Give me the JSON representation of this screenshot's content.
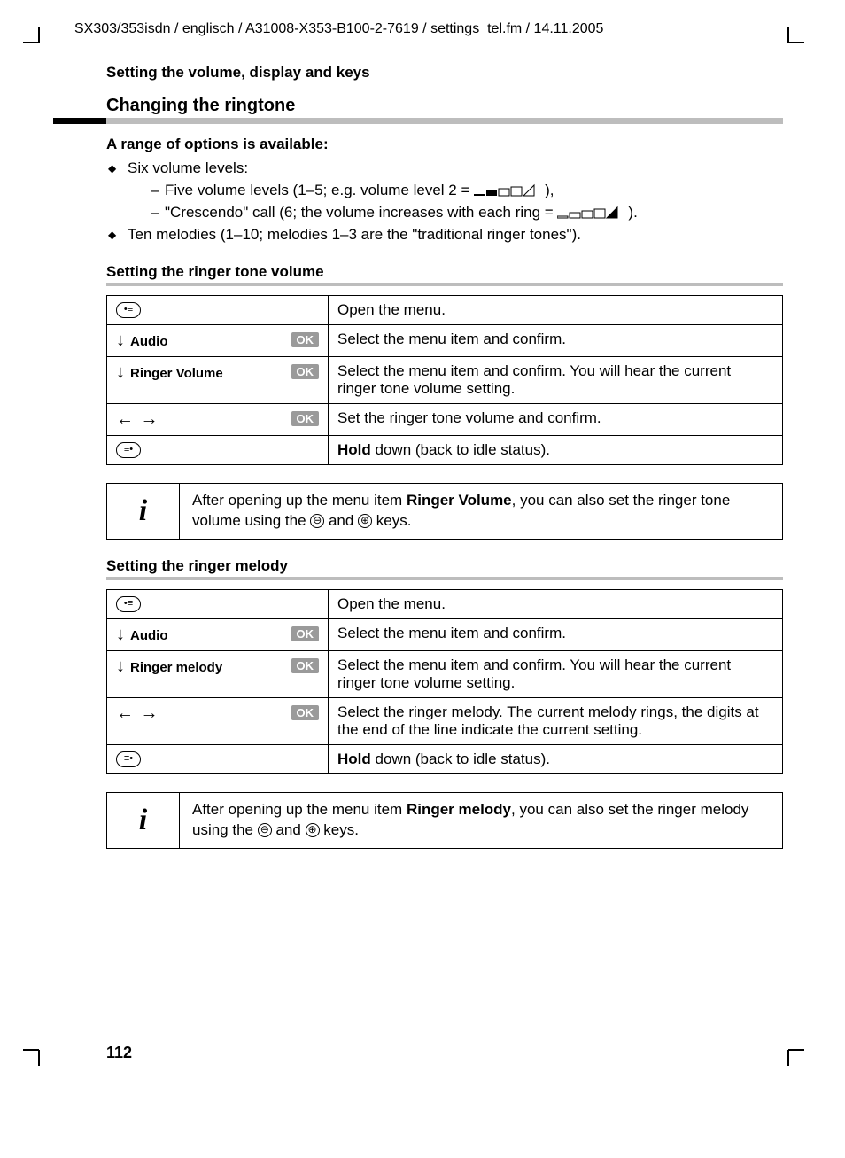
{
  "header_path": "SX303/353isdn / englisch / A31008-X353-B100-2-7619 / settings_tel.fm / 14.11.2005",
  "section_title": "Setting the volume, display and keys",
  "h2": "Changing the ringtone",
  "intro_bold": "A range of options is available:",
  "bullet1": "Six volume levels:",
  "dash1_pre": "Five volume levels (1–5; e.g. volume level 2 = ",
  "dash1_post": "),",
  "dash2_pre": "\"Crescendo\" call (6; the volume increases with each ring = ",
  "dash2_post": ").",
  "bullet2": "Ten melodies (1–10; melodies 1–3 are the \"traditional ringer tones\").",
  "h3a": "Setting the ringer tone volume",
  "table_a": {
    "r1_desc": "Open the menu.",
    "r2_label": "Audio",
    "r2_desc": "Select the menu item and confirm.",
    "r3_label": "Ringer Volume",
    "r3_desc": "Select the menu item and confirm. You will hear the current ringer tone volume setting.",
    "r4_desc": "Set the ringer tone volume and confirm.",
    "r5_hold": "Hold",
    "r5_rest": " down (back to idle status).",
    "ok": "OK"
  },
  "info_a_pre": "After opening up the menu item ",
  "info_a_bold": "Ringer Volume",
  "info_a_mid": ", you can also set the ringer tone volume using the ",
  "info_a_and": " and ",
  "info_a_post": " keys.",
  "h3b": "Setting the ringer melody",
  "table_b": {
    "r1_desc": "Open the menu.",
    "r2_label": "Audio",
    "r2_desc": "Select the menu item and confirm.",
    "r3_label": "Ringer melody",
    "r3_desc": "Select the menu item and confirm. You will hear the current ringer tone volume setting.",
    "r4_desc": "Select the ringer melody. The current melody rings, the digits at the end of the line indicate the current setting.",
    "r5_hold": "Hold",
    "r5_rest": " down (back to idle status).",
    "ok": "OK"
  },
  "info_b_pre": "After opening up the menu item ",
  "info_b_bold": "Ringer melody",
  "info_b_mid": ", you can also set the ringer melody using the ",
  "info_b_and": " and ",
  "info_b_post": " keys.",
  "page_num": "112",
  "key_minus": "⊖",
  "key_plus": "⊕",
  "menu_key": "•≡",
  "end_key": "≡•"
}
